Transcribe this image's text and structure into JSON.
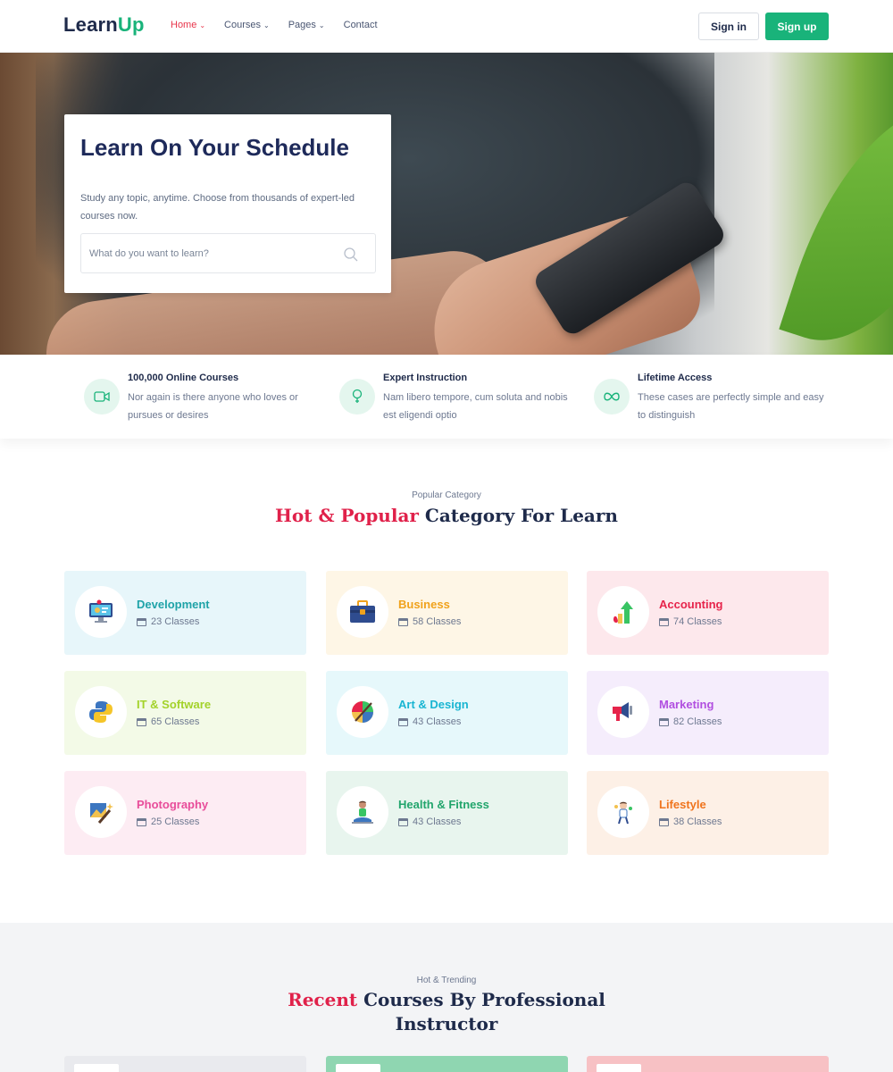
{
  "header": {
    "logo_learn": "Learn",
    "logo_up": "Up",
    "nav": [
      {
        "label": "Home",
        "active": true,
        "has_dropdown": true
      },
      {
        "label": "Courses",
        "active": false,
        "has_dropdown": true
      },
      {
        "label": "Pages",
        "active": false,
        "has_dropdown": true
      },
      {
        "label": "Contact",
        "active": false,
        "has_dropdown": false
      }
    ],
    "signin_label": "Sign in",
    "signup_label": "Sign up"
  },
  "hero": {
    "title": "Learn On Your Schedule",
    "subtitle": "Study any topic, anytime. Choose from thousands of expert-led courses now.",
    "search_placeholder": "What do you want to learn?"
  },
  "features": [
    {
      "title": "100,000 Online Courses",
      "text": "Nor again is there anyone who loves or pursues or desires",
      "icon": "video-icon"
    },
    {
      "title": "Expert Instruction",
      "text": "Nam libero tempore, cum soluta and nobis est eligendi optio",
      "icon": "bulb-icon"
    },
    {
      "title": "Lifetime Access",
      "text": "These cases are perfectly simple and easy to distinguish",
      "icon": "infinity-icon"
    }
  ],
  "categories_section": {
    "pretitle": "Popular Category",
    "heading_highlight": "Hot & Popular",
    "heading_rest": " Category For Learn",
    "items": [
      {
        "name": "Development",
        "count": "23 Classes",
        "color": "#1fa3a8",
        "bg": "#e7f6fa",
        "icon": "monitor-icon"
      },
      {
        "name": "Business",
        "count": "58 Classes",
        "color": "#f0a21c",
        "bg": "#fef6e6",
        "icon": "briefcase-icon"
      },
      {
        "name": "Accounting",
        "count": "74 Classes",
        "color": "#e6244b",
        "bg": "#fde8ec",
        "icon": "growth-chart-icon"
      },
      {
        "name": "IT & Software",
        "count": "65 Classes",
        "color": "#a3d22a",
        "bg": "#f3fae7",
        "icon": "python-icon"
      },
      {
        "name": "Art & Design",
        "count": "43 Classes",
        "color": "#19b5d2",
        "bg": "#e6f8fb",
        "icon": "palette-icon"
      },
      {
        "name": "Marketing",
        "count": "82 Classes",
        "color": "#b14fe0",
        "bg": "#f5edfc",
        "icon": "megaphone-icon"
      },
      {
        "name": "Photography",
        "count": "25 Classes",
        "color": "#e84d9a",
        "bg": "#fdecf3",
        "icon": "photo-icon"
      },
      {
        "name": "Health & Fitness",
        "count": "43 Classes",
        "color": "#22a56c",
        "bg": "#e8f5ee",
        "icon": "yoga-icon"
      },
      {
        "name": "Lifestyle",
        "count": "38 Classes",
        "color": "#f0741d",
        "bg": "#fdf0e6",
        "icon": "lifestyle-icon"
      }
    ]
  },
  "recent_section": {
    "pretitle": "Hot & Trending",
    "heading_highlight": "Recent",
    "heading_rest": " Courses By Professional Instructor",
    "cards": [
      {
        "bg": "#e9eaee"
      },
      {
        "bg": "#8fd6b1"
      },
      {
        "bg": "#f7c1c4"
      }
    ]
  },
  "colors": {
    "brand_green": "#19b37a",
    "accent_red": "#e0214a",
    "navy": "#1e2a4a"
  }
}
